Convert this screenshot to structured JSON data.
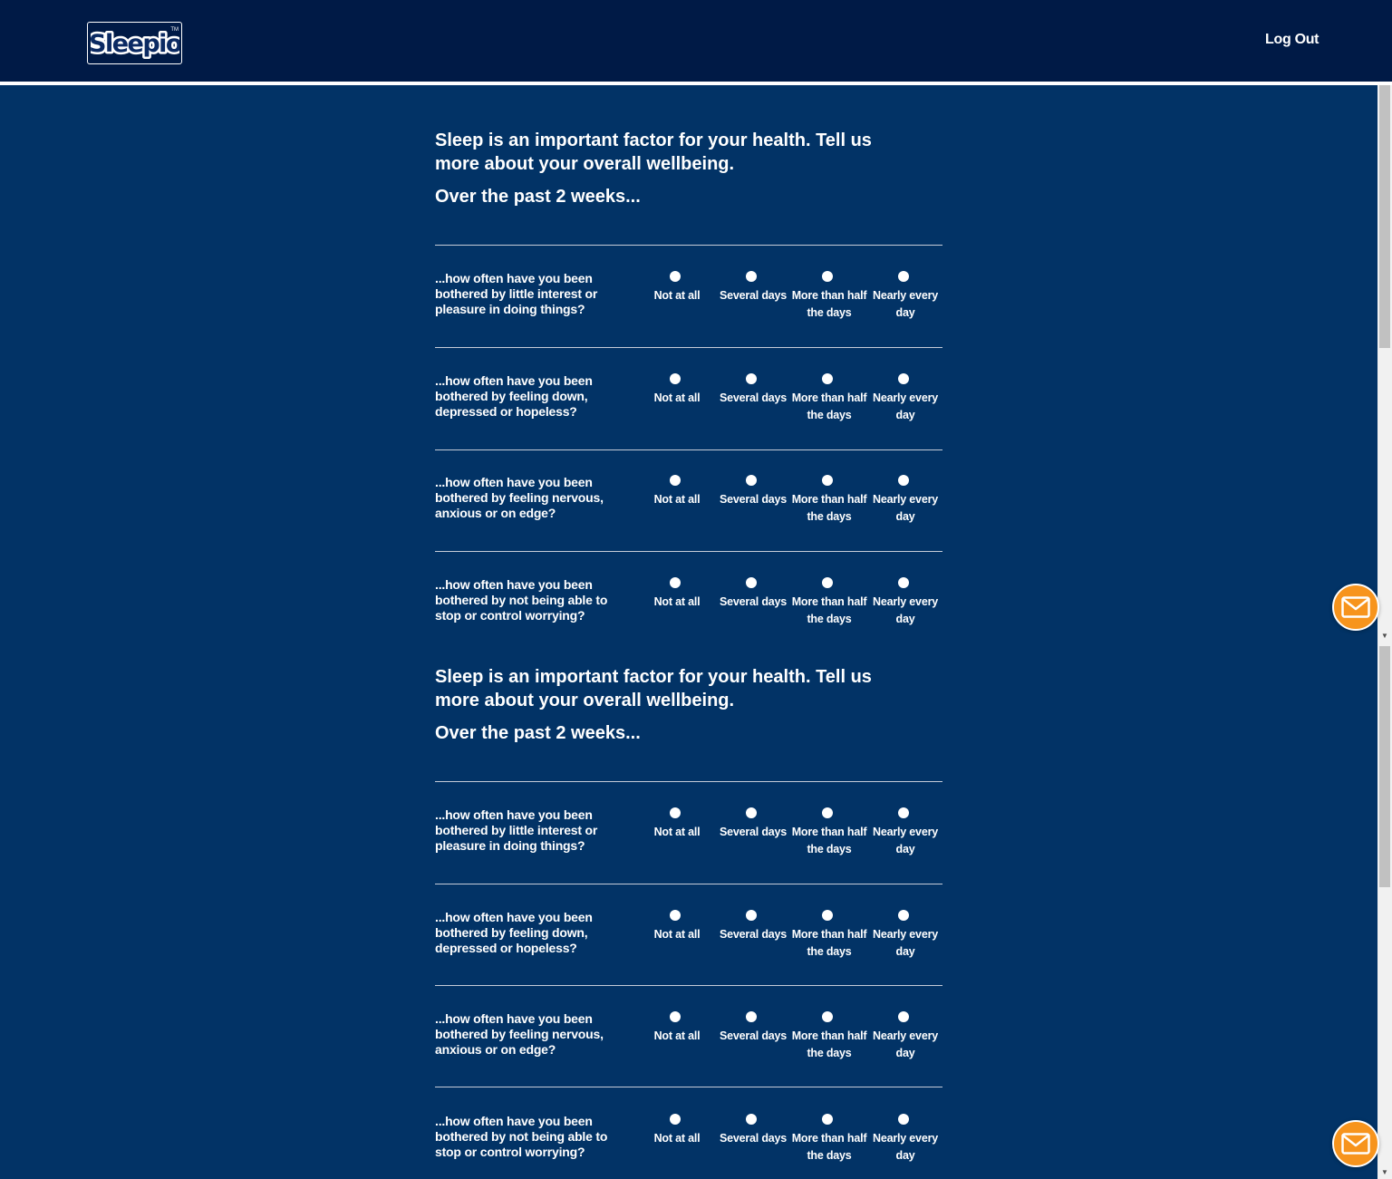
{
  "header": {
    "logo_text": "Sleepio",
    "logout_label": "Log Out"
  },
  "sections": [
    {
      "intro": "Sleep is an important factor for your health. Tell us more about your overall wellbeing.",
      "subhead": "Over the past 2 weeks...",
      "questions": [
        "...how often have you been bothered by little interest or pleasure in doing things?",
        "...how often have you been bothered by feeling down, depressed or hopeless?",
        "...how often have you been bothered by feeling nervous, anxious or on edge?",
        "...how often have you been bothered by not being able to stop or control worrying?"
      ]
    },
    {
      "intro": "Sleep is an important factor for your health. Tell us more about your overall wellbeing.",
      "subhead": "Over the past 2 weeks...",
      "questions": [
        "...how often have you been bothered by little interest or pleasure in doing things?",
        "...how often have you been bothered by feeling down, depressed or hopeless?",
        "...how often have you been bothered by feeling nervous, anxious or on edge?",
        "...how often have you been bothered by not being able to stop or control worrying?"
      ]
    }
  ],
  "options": [
    "Not at all",
    "Several days",
    "More than half the days",
    "Nearly every day"
  ],
  "colors": {
    "header_bg": "#001A46",
    "page_bg": "#023366",
    "accent_button": "#F7941D"
  },
  "icons": {
    "message_button": "envelope-icon"
  }
}
